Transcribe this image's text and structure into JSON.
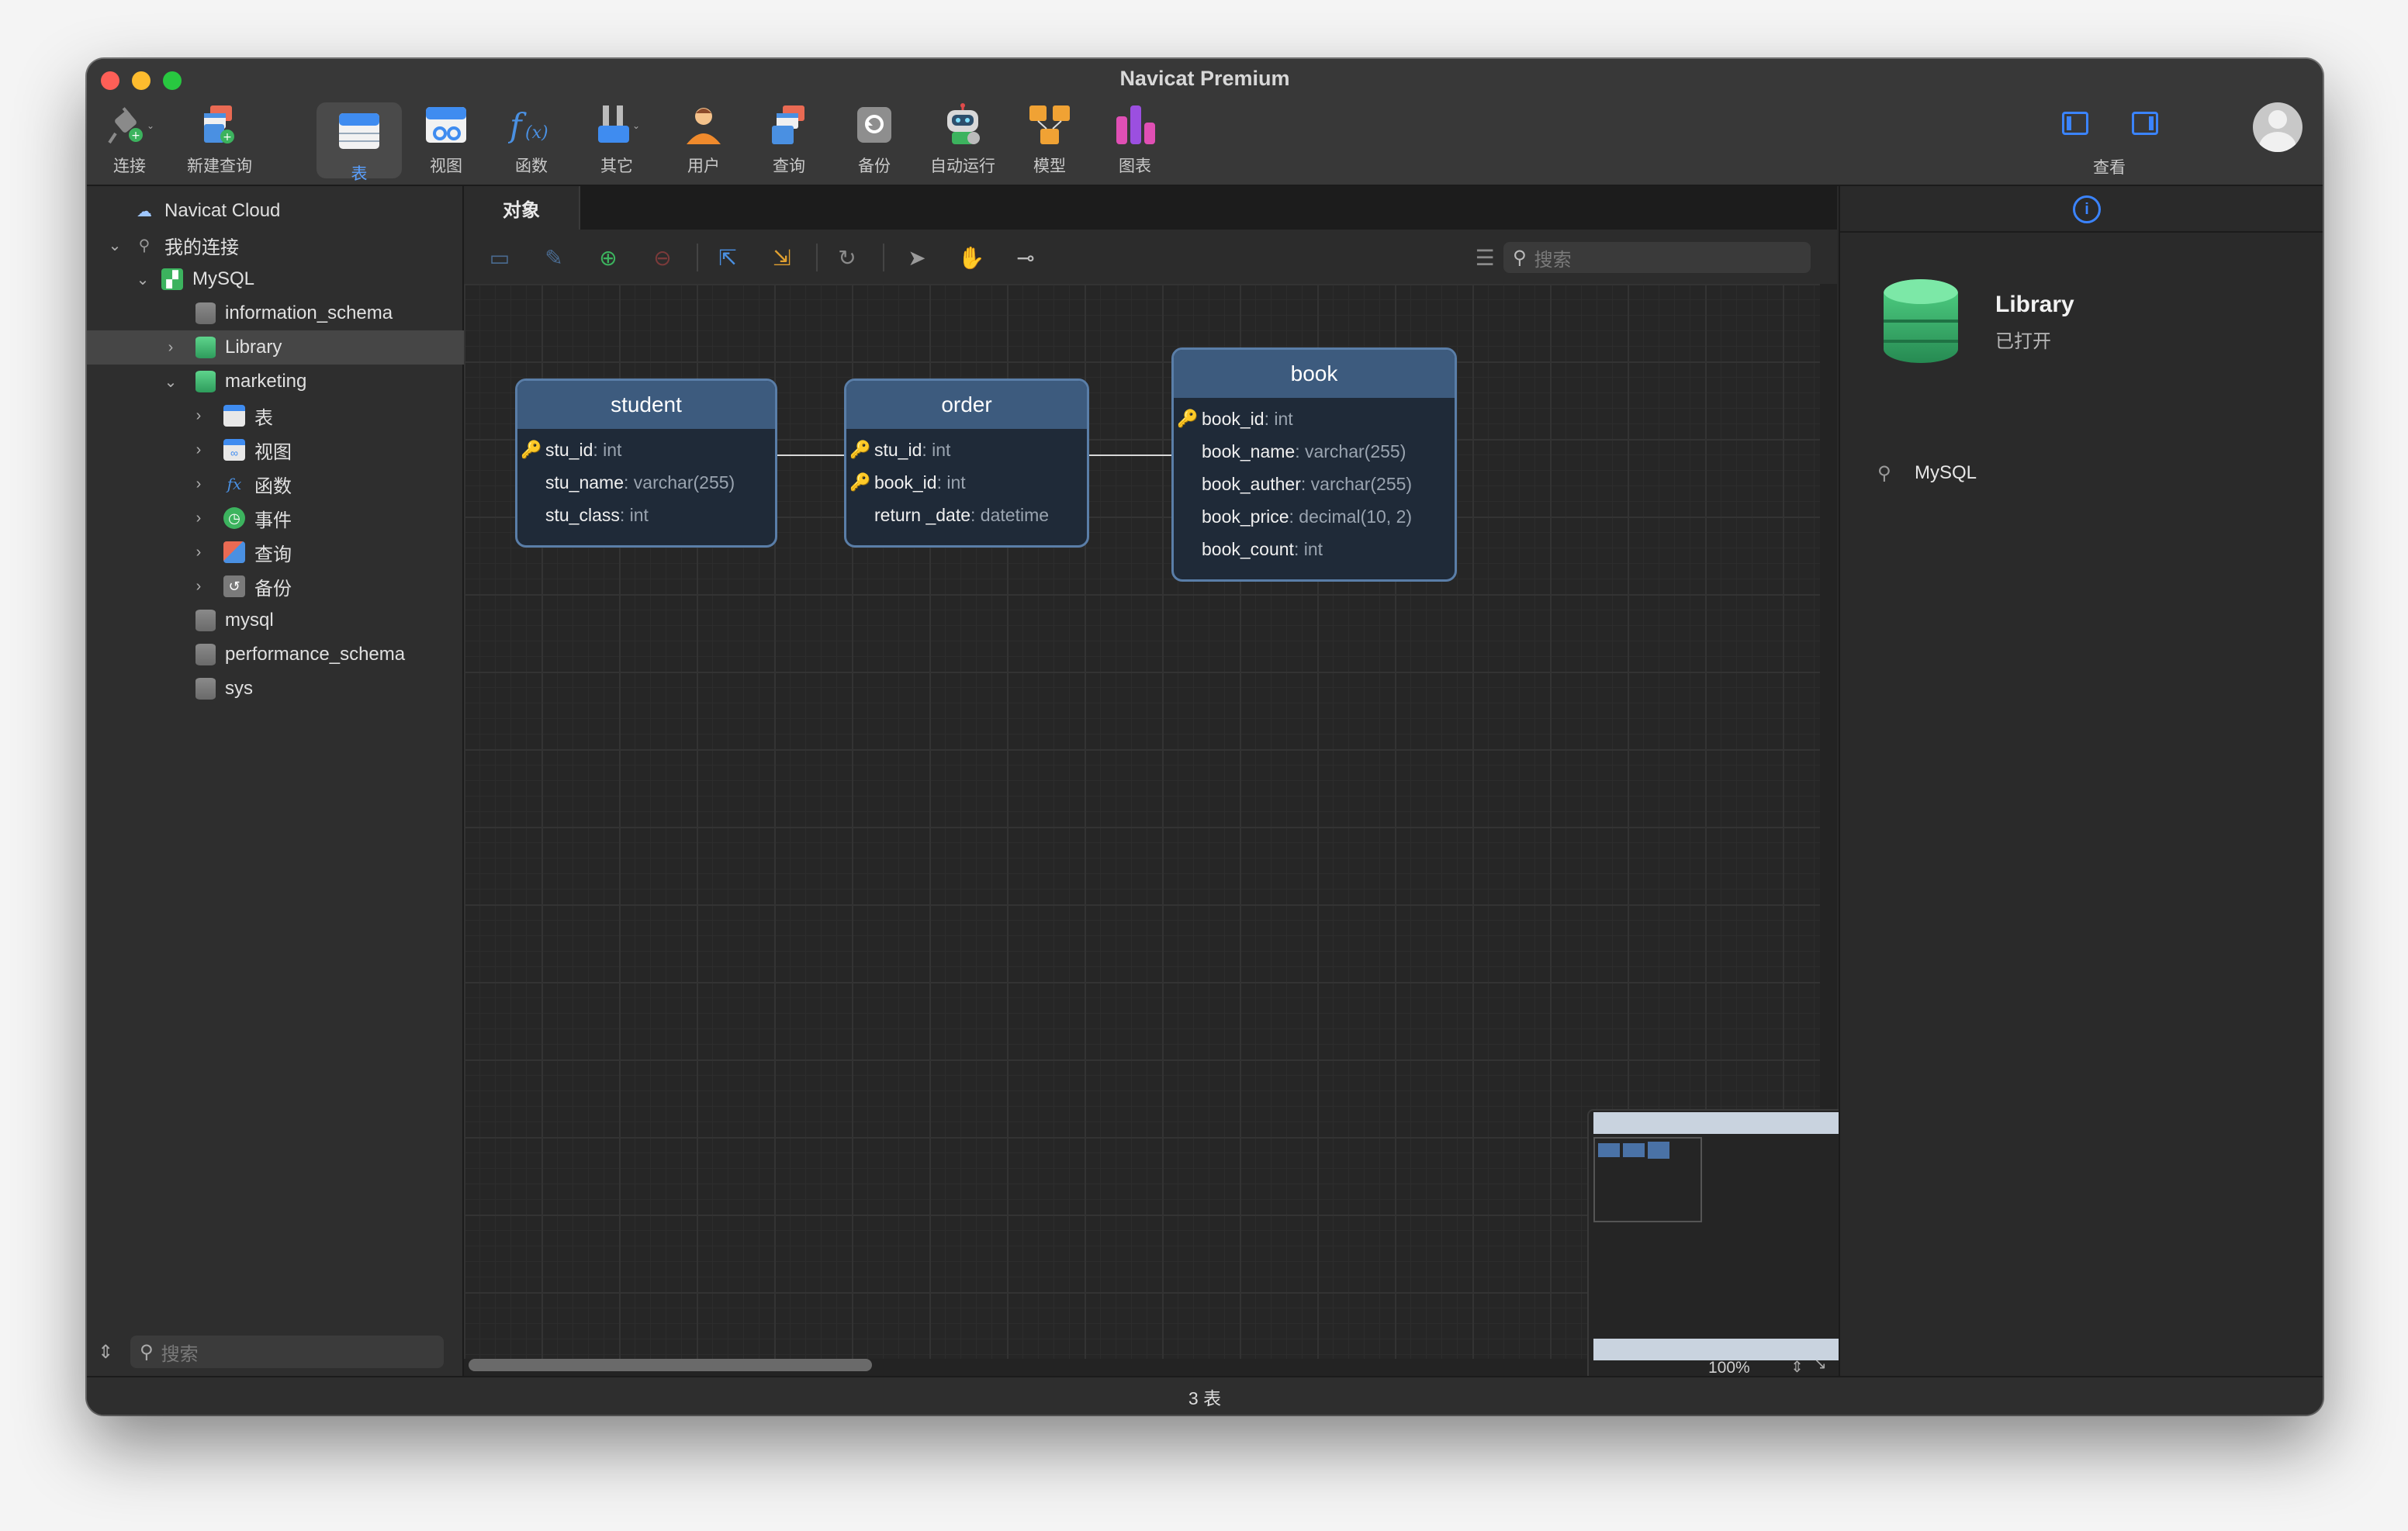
{
  "window": {
    "title": "Navicat Premium"
  },
  "toolbar": {
    "items": [
      {
        "label": "连接",
        "icon": "connection-plug-icon"
      },
      {
        "label": "新建查询",
        "icon": "new-query-icon"
      },
      {
        "label": "表",
        "icon": "table-icon",
        "active": true
      },
      {
        "label": "视图",
        "icon": "view-icon"
      },
      {
        "label": "函数",
        "icon": "function-icon"
      },
      {
        "label": "其它",
        "icon": "tools-icon"
      },
      {
        "label": "用户",
        "icon": "user-icon"
      },
      {
        "label": "查询",
        "icon": "query-icon"
      },
      {
        "label": "备份",
        "icon": "backup-icon"
      },
      {
        "label": "自动运行",
        "icon": "robot-icon"
      },
      {
        "label": "模型",
        "icon": "model-icon"
      },
      {
        "label": "图表",
        "icon": "chart-icon"
      }
    ],
    "view_label": "查看"
  },
  "sidebar": {
    "tree": [
      {
        "label": "Navicat Cloud",
        "icon": "cloud-icon"
      },
      {
        "label": "我的连接",
        "icon": "connection-icon",
        "expanded": true
      },
      {
        "label": "MySQL",
        "icon": "mysql-icon",
        "expanded": true
      },
      {
        "label": "information_schema",
        "icon": "database-icon"
      },
      {
        "label": "Library",
        "icon": "database-icon",
        "selected": true
      },
      {
        "label": "marketing",
        "icon": "database-icon",
        "expanded": true
      },
      {
        "label": "表",
        "icon": "table-icon"
      },
      {
        "label": "视图",
        "icon": "view-icon"
      },
      {
        "label": "函数",
        "icon": "function-icon"
      },
      {
        "label": "事件",
        "icon": "event-icon"
      },
      {
        "label": "查询",
        "icon": "query-icon"
      },
      {
        "label": "备份",
        "icon": "backup-icon"
      },
      {
        "label": "mysql",
        "icon": "database-icon"
      },
      {
        "label": "performance_schema",
        "icon": "database-icon"
      },
      {
        "label": "sys",
        "icon": "database-icon"
      }
    ],
    "search_placeholder": "搜索"
  },
  "main": {
    "tab_label": "对象",
    "search_placeholder": "搜索",
    "zoom": "100%",
    "erd": {
      "tables": [
        {
          "name": "student",
          "fields": [
            {
              "name": "stu_id",
              "type": ": int",
              "key": true
            },
            {
              "name": "stu_name",
              "type": ": varchar(255)",
              "key": false
            },
            {
              "name": "stu_class",
              "type": ": int",
              "key": false
            }
          ]
        },
        {
          "name": "order",
          "fields": [
            {
              "name": "stu_id",
              "type": ": int",
              "key": true
            },
            {
              "name": "book_id",
              "type": ": int",
              "key": true
            },
            {
              "name": "return _date",
              "type": ": datetime",
              "key": false
            }
          ]
        },
        {
          "name": "book",
          "fields": [
            {
              "name": "book_id",
              "type": ": int",
              "key": true
            },
            {
              "name": "book_name",
              "type": ": varchar(255)",
              "key": false
            },
            {
              "name": "book_auther",
              "type": ": varchar(255)",
              "key": false
            },
            {
              "name": "book_price",
              "type": ": decimal(10, 2)",
              "key": false
            },
            {
              "name": "book_count",
              "type": ": int",
              "key": false
            }
          ]
        }
      ]
    }
  },
  "info_panel": {
    "db_name": "Library",
    "status": "已打开",
    "connection": "MySQL"
  },
  "statusbar": {
    "text": "3 表"
  },
  "colors": {
    "accent": "#3b84ff",
    "table_header": "#3d5b7e",
    "db_green": "#3cb96a"
  }
}
